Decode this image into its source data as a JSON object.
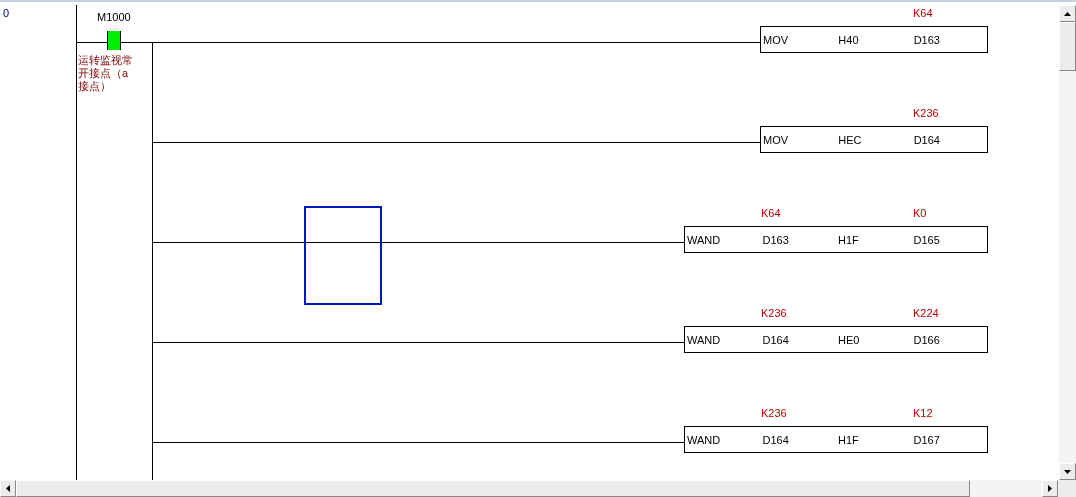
{
  "step": "0",
  "contact": {
    "label": "M1000",
    "on": true,
    "comment": "运转监视常开接点（a接点）"
  },
  "rungs": [
    {
      "selected": false,
      "operands": [
        {
          "text": "MOV"
        },
        {
          "text": "H40"
        },
        {
          "text": "D163",
          "value": "K64"
        }
      ]
    },
    {
      "selected": false,
      "operands": [
        {
          "text": "MOV"
        },
        {
          "text": "HEC"
        },
        {
          "text": "D164",
          "value": "K236"
        }
      ]
    },
    {
      "selected": true,
      "operands": [
        {
          "text": "WAND"
        },
        {
          "text": "D163",
          "value": "K64"
        },
        {
          "text": "H1F"
        },
        {
          "text": "D165",
          "value": "K0"
        }
      ]
    },
    {
      "selected": false,
      "operands": [
        {
          "text": "WAND"
        },
        {
          "text": "D164",
          "value": "K236"
        },
        {
          "text": "HE0"
        },
        {
          "text": "D166",
          "value": "K224"
        }
      ]
    },
    {
      "selected": false,
      "operands": [
        {
          "text": "WAND"
        },
        {
          "text": "D164",
          "value": "K236"
        },
        {
          "text": "H1F"
        },
        {
          "text": "D167",
          "value": "K12"
        }
      ]
    }
  ]
}
